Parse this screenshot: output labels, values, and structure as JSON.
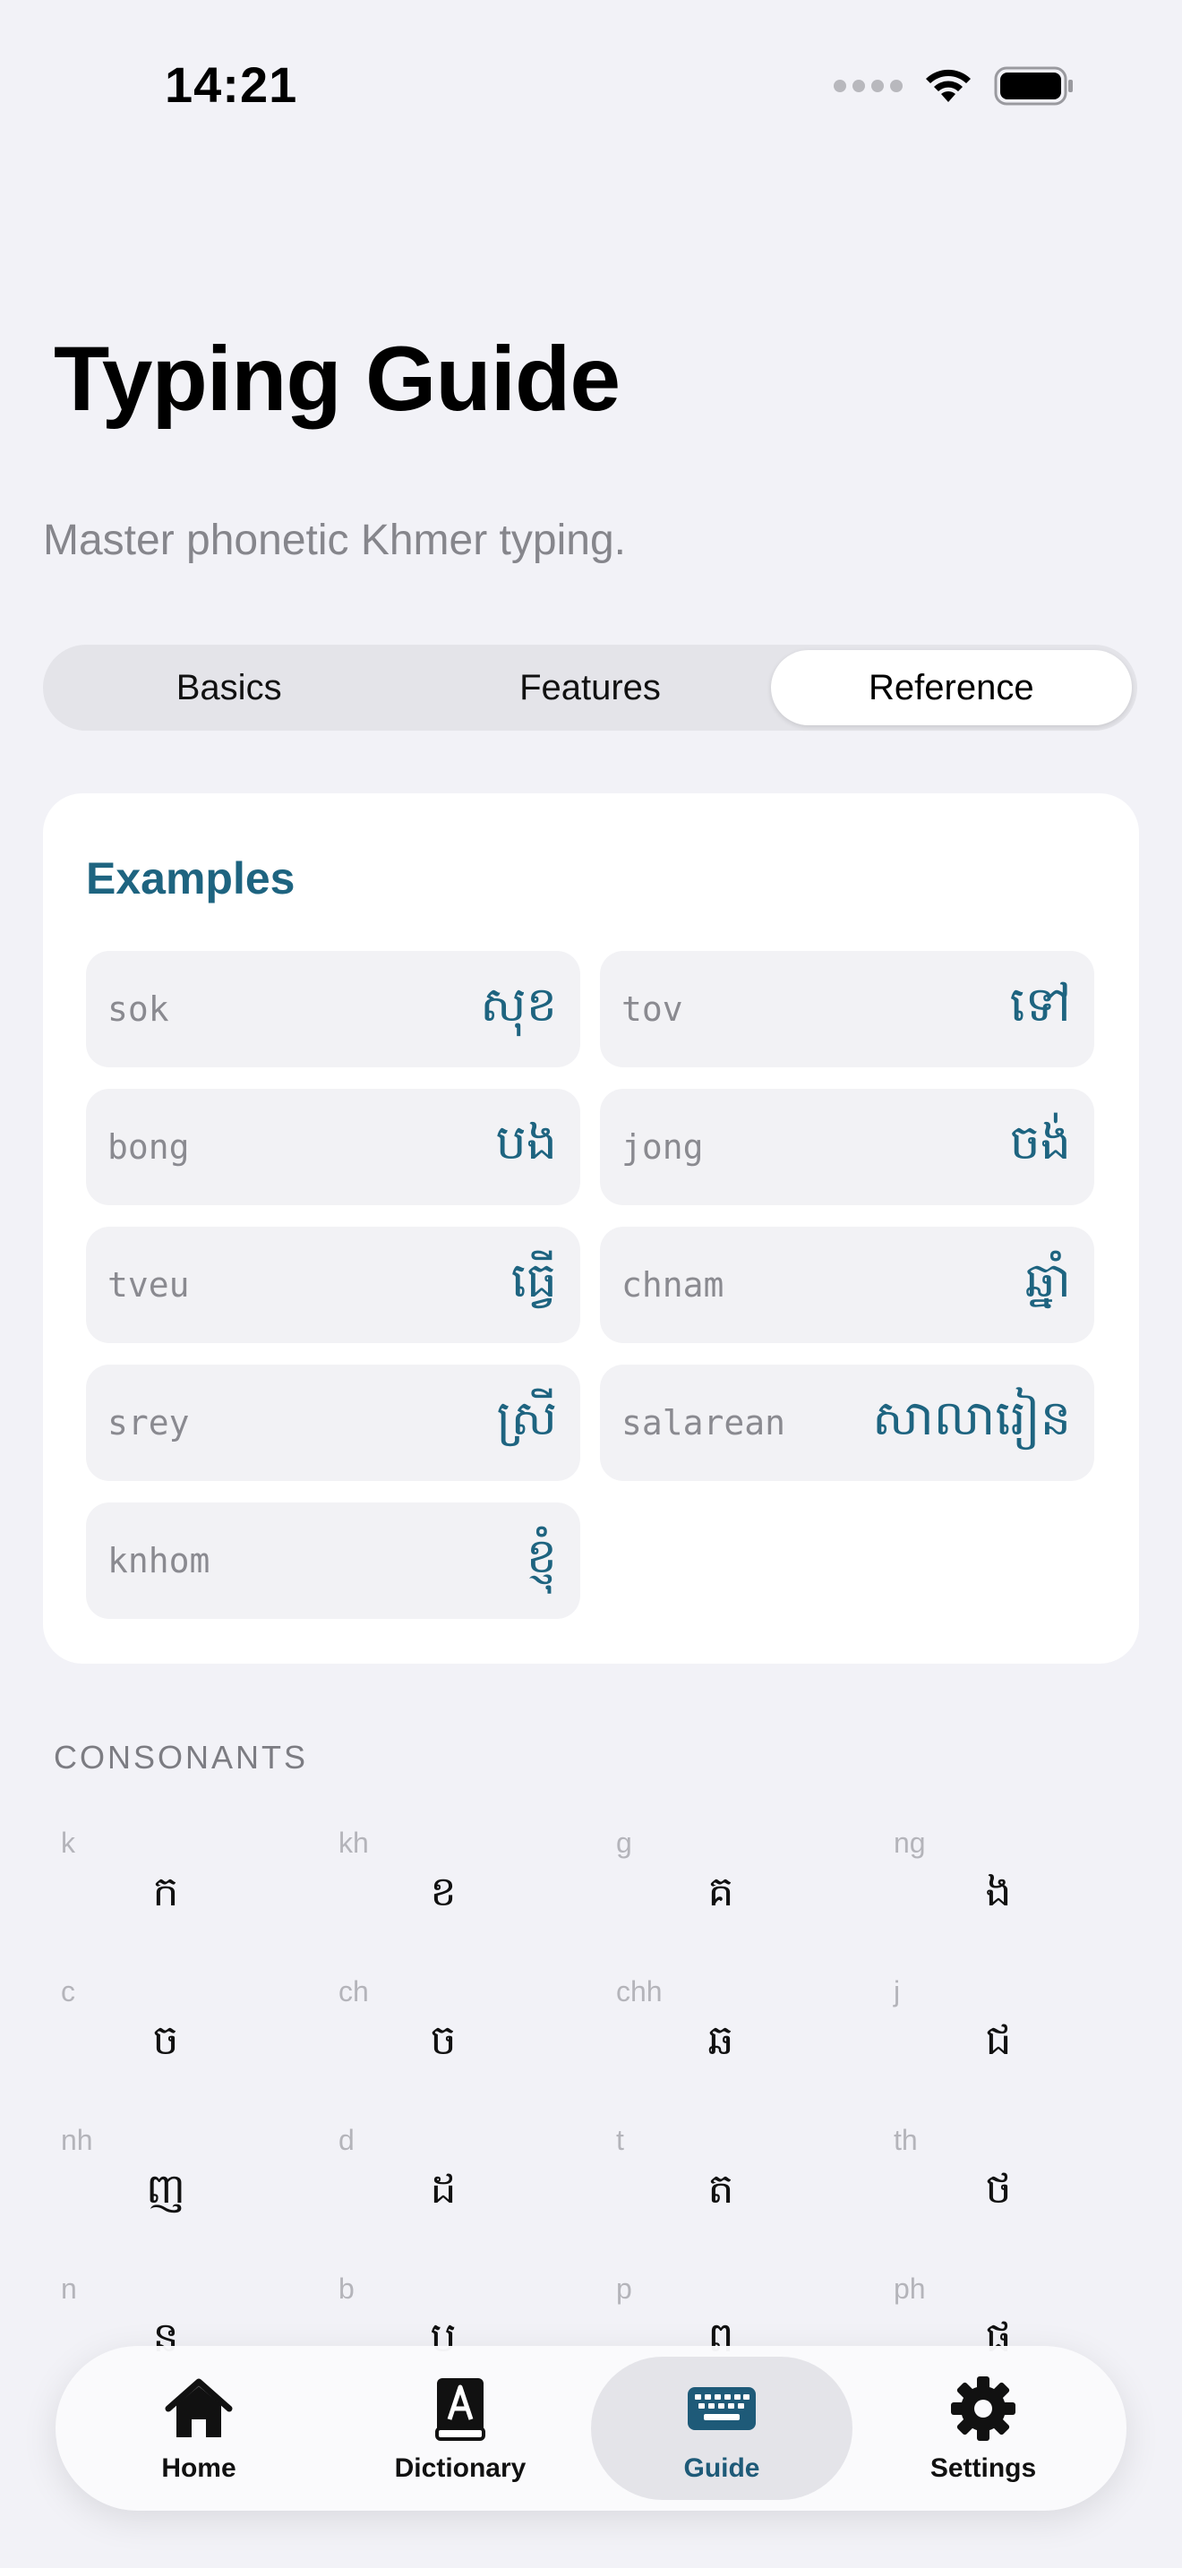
{
  "status_bar": {
    "time": "14:21"
  },
  "header": {
    "title": "Typing Guide",
    "subtitle": "Master phonetic Khmer typing."
  },
  "segments": [
    {
      "label": "Basics",
      "active": false
    },
    {
      "label": "Features",
      "active": false
    },
    {
      "label": "Reference",
      "active": true
    }
  ],
  "examples": {
    "title": "Examples",
    "items": [
      {
        "latin": "sok",
        "khmer": "សុខ"
      },
      {
        "latin": "tov",
        "khmer": "ទៅ"
      },
      {
        "latin": "bong",
        "khmer": "បង"
      },
      {
        "latin": "jong",
        "khmer": "ចង់"
      },
      {
        "latin": "tveu",
        "khmer": "ធ្វើ"
      },
      {
        "latin": "chnam",
        "khmer": "ឆ្នាំ"
      },
      {
        "latin": "srey",
        "khmer": "ស្រី"
      },
      {
        "latin": "salarean",
        "khmer": "សាលារៀន"
      },
      {
        "latin": "knhom",
        "khmer": "ខ្ញុំ"
      }
    ]
  },
  "consonants": {
    "label": "CONSONANTS",
    "items": [
      {
        "roman": "k",
        "khmer": "ក"
      },
      {
        "roman": "kh",
        "khmer": "ខ"
      },
      {
        "roman": "g",
        "khmer": "គ"
      },
      {
        "roman": "ng",
        "khmer": "ង"
      },
      {
        "roman": "c",
        "khmer": "ច"
      },
      {
        "roman": "ch",
        "khmer": "ច"
      },
      {
        "roman": "chh",
        "khmer": "ឆ"
      },
      {
        "roman": "j",
        "khmer": "ជ"
      },
      {
        "roman": "nh",
        "khmer": "ញ"
      },
      {
        "roman": "d",
        "khmer": "ដ"
      },
      {
        "roman": "t",
        "khmer": "ត"
      },
      {
        "roman": "th",
        "khmer": "ថ"
      },
      {
        "roman": "n",
        "khmer": "ន"
      },
      {
        "roman": "b",
        "khmer": "ប"
      },
      {
        "roman": "p",
        "khmer": "ព"
      },
      {
        "roman": "ph",
        "khmer": "ផ"
      }
    ]
  },
  "tab_bar": {
    "items": [
      {
        "label": "Home",
        "icon": "house-icon",
        "active": false
      },
      {
        "label": "Dictionary",
        "icon": "book-icon",
        "active": false
      },
      {
        "label": "Guide",
        "icon": "keyboard-icon",
        "active": true
      },
      {
        "label": "Settings",
        "icon": "gear-icon",
        "active": false
      }
    ]
  },
  "colors": {
    "accent": "#1e6480",
    "background": "#f2f2f7",
    "card": "#ffffff"
  }
}
